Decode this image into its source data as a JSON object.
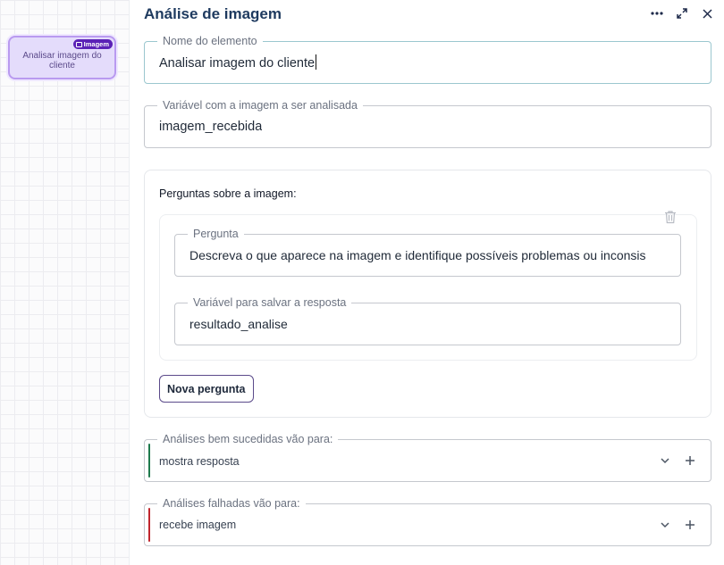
{
  "canvas": {
    "node": {
      "label": "Analisar imagem do cliente",
      "badge": "Imagem"
    }
  },
  "panel": {
    "title": "Análise de imagem",
    "header_icons": [
      "more-dots-icon",
      "expand-icon",
      "close-icon"
    ]
  },
  "element_name": {
    "legend": "Nome do elemento",
    "value": "Analisar imagem do cliente"
  },
  "image_variable": {
    "legend": "Variável com a imagem a ser analisada",
    "value": "imagem_recebida"
  },
  "questions": {
    "title": "Perguntas sobre a imagem:",
    "items": [
      {
        "question_legend": "Pergunta",
        "question_value": "Descreva o que aparece na imagem e identifique possíveis problemas ou inconsis",
        "answer_legend": "Variável para salvar a resposta",
        "answer_value": "resultado_analise"
      }
    ],
    "new_button_label": "Nova pergunta"
  },
  "success_route": {
    "legend": "Análises bem sucedidas vão para:",
    "value": "mostra resposta",
    "color": "#1f7a4d"
  },
  "failure_route": {
    "legend": "Análises falhadas vão para:",
    "value": "recebe imagem",
    "color": "#c0262d"
  },
  "colors": {
    "title": "#1e3a5f",
    "node_fill": "#e4dcfb",
    "node_border": "#b99af0",
    "badge": "#5b21b6",
    "button_border": "#5b4a8a"
  }
}
